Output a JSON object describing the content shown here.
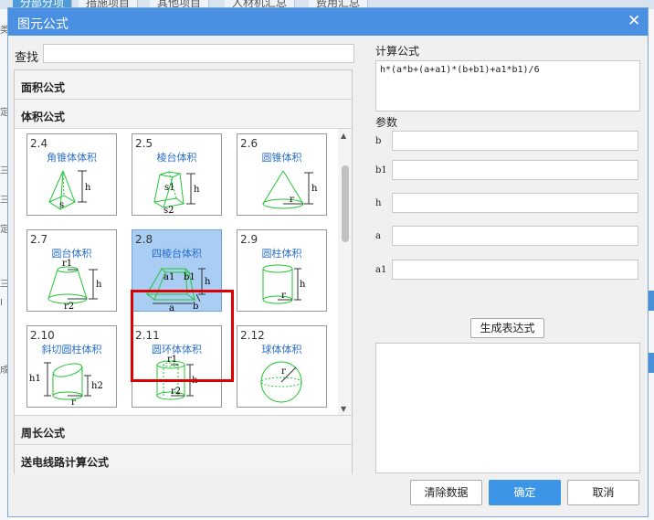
{
  "background": {
    "tabs": [
      "分部分项",
      "措施项目",
      "其他项目",
      "人材机汇总",
      "费用汇总"
    ],
    "left_marks": [
      "类",
      "定",
      "三",
      "三",
      "定",
      "三",
      "I",
      "成"
    ]
  },
  "dialog": {
    "title": "图元公式",
    "search_label": "查找",
    "search_value": "",
    "categories": {
      "area": "面积公式",
      "volume": "体积公式",
      "perimeter": "周长公式",
      "power_line": "送电线路计算公式"
    },
    "cards": [
      {
        "num": "2.4",
        "name": "角锥体体积",
        "labels": [
          "h",
          "s"
        ]
      },
      {
        "num": "2.5",
        "name": "棱台体积",
        "labels": [
          "s1",
          "h",
          "s2"
        ]
      },
      {
        "num": "2.6",
        "name": "圆锥体积",
        "labels": [
          "h",
          "r"
        ]
      },
      {
        "num": "2.7",
        "name": "圆台体积",
        "labels": [
          "r1",
          "h",
          "r2"
        ]
      },
      {
        "num": "2.8",
        "name": "四棱台体积",
        "labels": [
          "a1",
          "b1",
          "h",
          "a",
          "b"
        ]
      },
      {
        "num": "2.9",
        "name": "圆柱体积",
        "labels": [
          "h",
          "r"
        ]
      },
      {
        "num": "2.10",
        "name": "斜切圆柱体积",
        "labels": [
          "h1",
          "h2",
          "r"
        ]
      },
      {
        "num": "2.11",
        "name": "圆环体体积",
        "labels": [
          "r1",
          "h",
          "r2"
        ]
      },
      {
        "num": "2.12",
        "name": "球体体积",
        "labels": [
          "r"
        ]
      }
    ],
    "selected_card": "2.8",
    "formula_label": "计算公式",
    "formula": "h*(a*b+(a+a1)*(b+b1)+a1*b1)/6",
    "params_label": "参数",
    "params": [
      {
        "name": "b",
        "value": ""
      },
      {
        "name": "b1",
        "value": ""
      },
      {
        "name": "h",
        "value": ""
      },
      {
        "name": "a",
        "value": ""
      },
      {
        "name": "a1",
        "value": ""
      }
    ],
    "generate_button": "生成表达式",
    "expression": "",
    "clear_button": "清除数据",
    "ok_button": "确定",
    "cancel_button": "取消"
  },
  "colors": {
    "title_bar": "#4a90e2",
    "selection_highlight": "#a9cdf3",
    "selection_outline": "#dd0000",
    "shape_stroke": "#22c633",
    "card_title": "#2a6fc9",
    "primary_button": "#3b94e6"
  }
}
